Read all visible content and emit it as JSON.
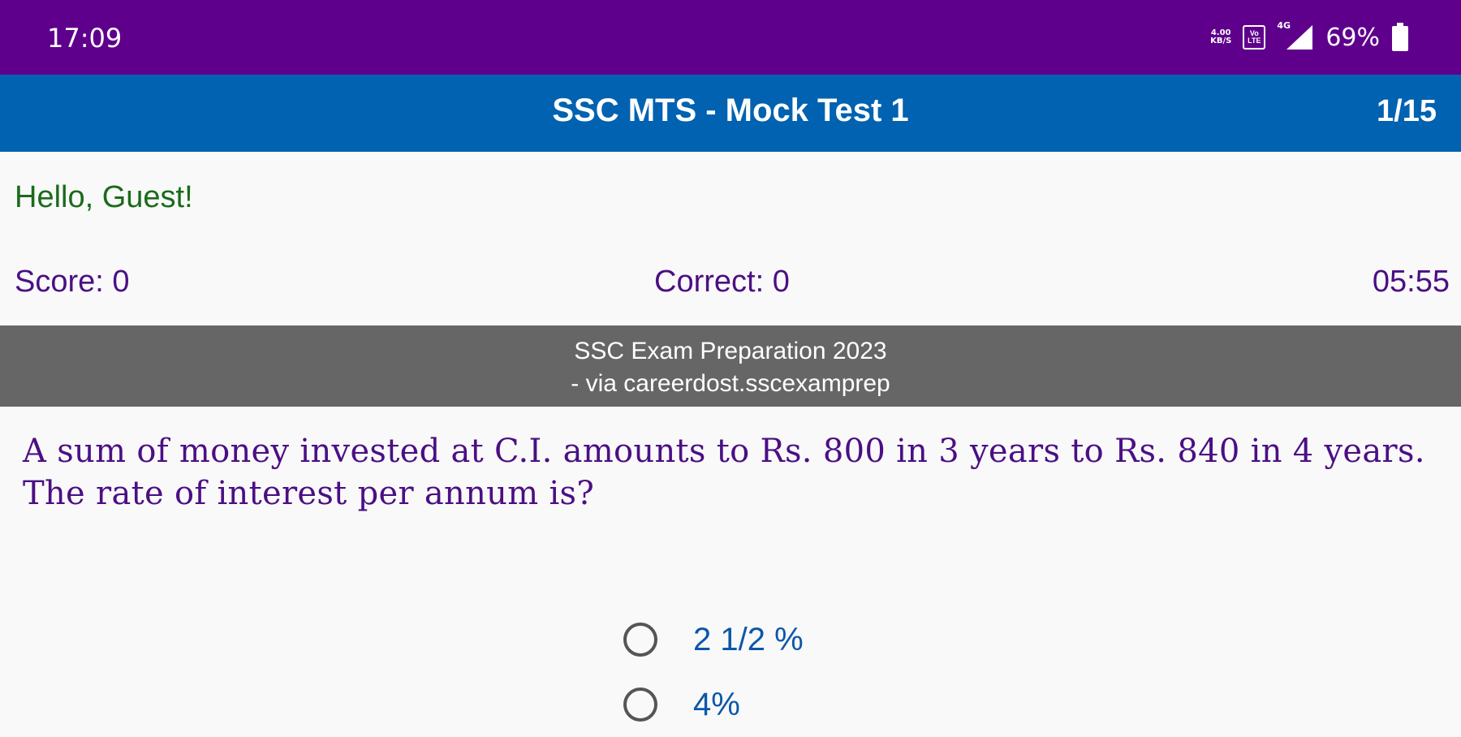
{
  "status_bar": {
    "time": "17:09",
    "speed_value": "4.00",
    "speed_unit": "KB/S",
    "volte_top": "Vo",
    "volte_bottom": "LTE",
    "network": "4G",
    "battery": "69%",
    "icons": [
      "network-speed-icon",
      "volte-icon",
      "signal-icon",
      "battery-icon"
    ]
  },
  "app_bar": {
    "title": "SSC MTS - Mock Test 1",
    "counter": "1/15"
  },
  "greeting": "Hello, Guest!",
  "stats": {
    "score": "Score: 0",
    "correct": "Correct: 0",
    "timer": "05:55"
  },
  "banner": {
    "line1": "SSC Exam Preparation 2023",
    "line2": "- via careerdost.sscexamprep"
  },
  "question": "A sum of money invested at C.I. amounts to Rs. 800 in 3 years to Rs. 840 in 4 years. The rate of interest per annum is?",
  "options": [
    {
      "label": "2 1/2 %",
      "selected": false
    },
    {
      "label": "4%",
      "selected": false
    }
  ],
  "colors": {
    "status_bar": "#5e008c",
    "app_bar": "#0062b0",
    "banner": "#666666",
    "greeting": "#1a6b1a",
    "stats": "#4b0f84",
    "question": "#4b0f84",
    "option_text": "#0b57a8"
  }
}
